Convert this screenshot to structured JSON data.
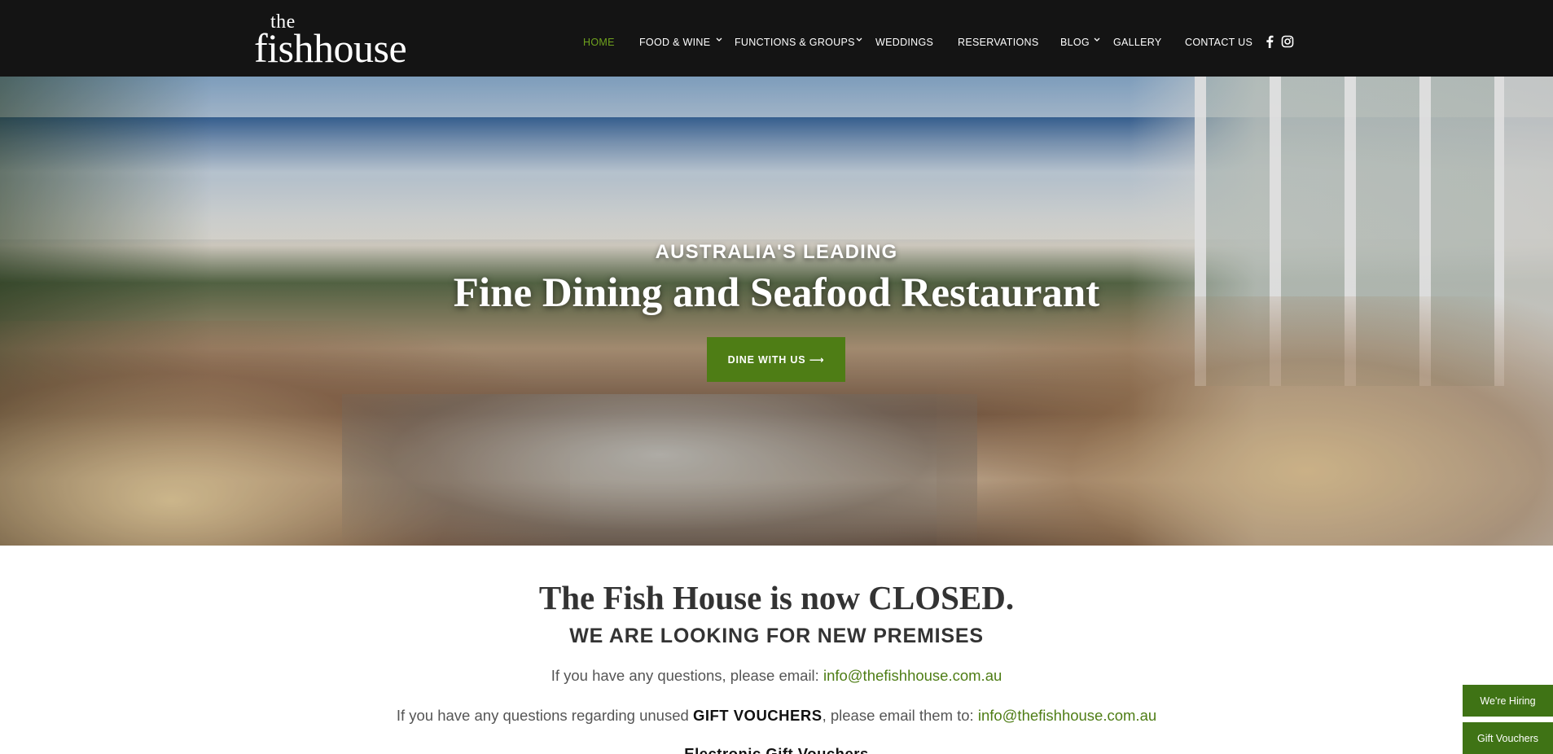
{
  "header": {
    "logo_the": "the",
    "logo_main": "fishhouse",
    "nav": [
      {
        "label": "HOME",
        "active": true
      },
      {
        "label": "FOOD & WINE",
        "dropdown": true
      },
      {
        "label": "FUNCTIONS & GROUPS",
        "dropdown": true
      },
      {
        "label": "WEDDINGS"
      },
      {
        "label": "RESERVATIONS"
      },
      {
        "label": "BLOG",
        "dropdown": true
      },
      {
        "label": "GALLERY"
      },
      {
        "label": "CONTACT US"
      }
    ],
    "social_icons": [
      "facebook-icon",
      "instagram-icon"
    ]
  },
  "hero": {
    "kicker": "AUSTRALIA'S LEADING",
    "title": "Fine Dining and Seafood Restaurant",
    "button": "DINE WITH US ⟶"
  },
  "content": {
    "closed_title": "The Fish House is now CLOSED.",
    "closed_sub": "WE ARE LOOKING FOR NEW PREMISES",
    "para1_text": "If you have any questions, please email: ",
    "para1_link": "info@thefishhouse.com.au",
    "para2_text_a": "If you have any questions regarding unused ",
    "para2_strong": "GIFT VOUCHERS",
    "para2_text_b": ", please email them to: ",
    "para2_link": "info@thefishhouse.com.au",
    "para3_strong": "Electronic Gift Vouchers"
  },
  "side_tabs": {
    "hiring": "We're Hiring",
    "vouchers": "Gift Vouchers"
  },
  "colors": {
    "header_bg": "#141414",
    "accent_green": "#4e7d15",
    "nav_active": "#6fa21e",
    "tab_green": "#3f7315"
  }
}
